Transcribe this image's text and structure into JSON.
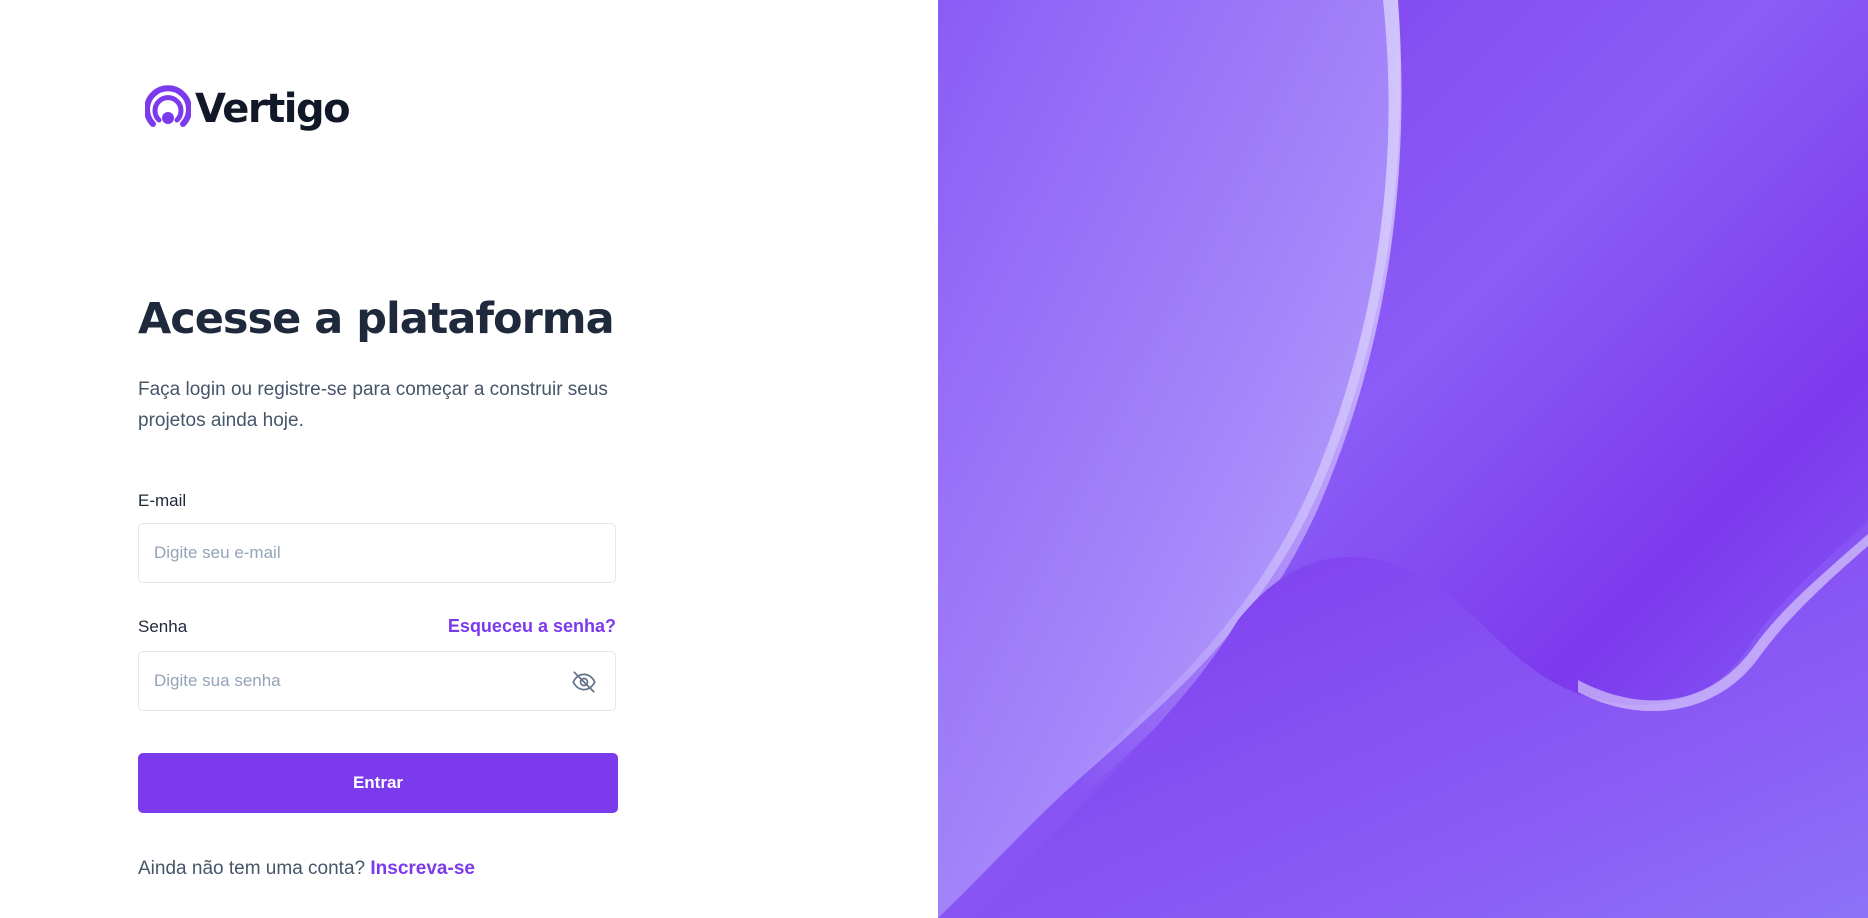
{
  "brand": {
    "name": "Vertigo",
    "accent_color": "#7c3aed",
    "logo_icon": "signal-rings-icon"
  },
  "login": {
    "title": "Acesse a plataforma",
    "subtitle": "Faça login ou registre-se para começar a construir seus projetos ainda hoje.",
    "email": {
      "label": "E-mail",
      "placeholder": "Digite seu e-mail",
      "value": ""
    },
    "password": {
      "label": "Senha",
      "placeholder": "Digite sua senha",
      "value": "",
      "visibility_icon": "eye-off-icon"
    },
    "forgot_password_label": "Esqueceu a senha?",
    "submit_label": "Entrar",
    "signup_prompt": "Ainda não tem uma conta?",
    "signup_link_label": "Inscreva-se"
  },
  "colors": {
    "title": "#1e293b",
    "text": "#475569",
    "placeholder": "#94a3b8",
    "border": "#e2e8f0",
    "hero_background": "#8b5cf6"
  }
}
